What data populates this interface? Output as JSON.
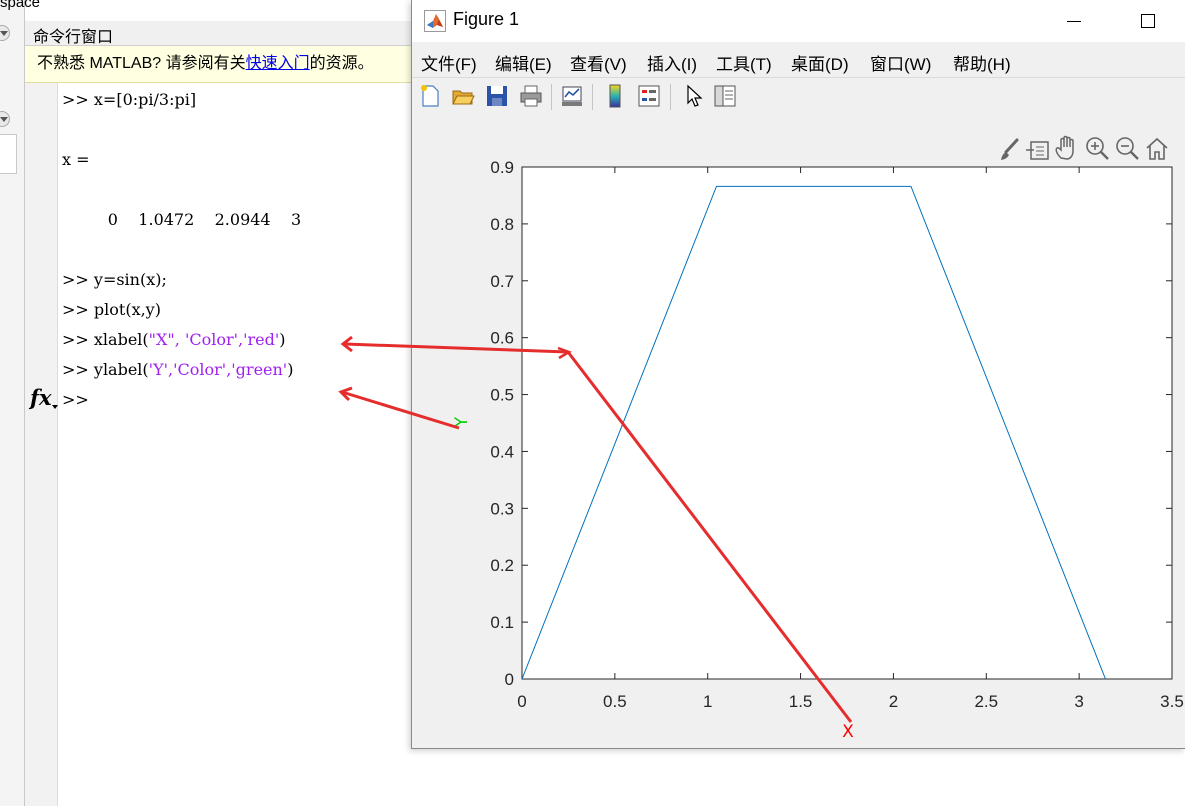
{
  "workspace": {
    "title": "space"
  },
  "command_window": {
    "title": "命令行窗口",
    "info": {
      "prefix": "不熟悉 MATLAB? 请参阅有关",
      "link": "快速入门",
      "suffix": "的资源。"
    },
    "lines": {
      "l1": ">> x=[0:pi/3:pi]",
      "l2": "x =",
      "l3": "         0    1.0472    2.0944    3",
      "l4": ">> y=sin(x);",
      "l5": ">> plot(x,y)",
      "l6a": ">> xlabel(",
      "l6b": "\"X\", 'Color','red'",
      "l6c": ")",
      "l7a": ">> ylabel(",
      "l7b": "'Y','Color','green'",
      "l7c": ")",
      "l8": ">>"
    }
  },
  "figure": {
    "title": "Figure 1",
    "menu": {
      "file": "文件(F)",
      "edit": "编辑(E)",
      "view": "查看(V)",
      "insert": "插入(I)",
      "tools": "工具(T)",
      "desktop": "桌面(D)",
      "window": "窗口(W)",
      "help": "帮助(H)"
    }
  },
  "colors": {
    "line": "#0072bd",
    "xlabel": "#ff0000",
    "ylabel": "#00cc00",
    "annotation": "#e52d2d",
    "string": "#a020f0"
  },
  "chart_data": {
    "type": "line",
    "x": [
      0,
      1.0472,
      2.0944,
      3.1416
    ],
    "series": [
      {
        "values": [
          0,
          0.866,
          0.866,
          0.0001
        ]
      }
    ],
    "xlabel": "X",
    "ylabel": "Y",
    "xlim": [
      0,
      3.5
    ],
    "ylim": [
      0,
      0.9
    ],
    "xticks": [
      "0",
      "0.5",
      "1",
      "1.5",
      "2",
      "2.5",
      "3",
      "3.5"
    ],
    "yticks": [
      "0",
      "0.1",
      "0.2",
      "0.3",
      "0.4",
      "0.5",
      "0.6",
      "0.7",
      "0.8",
      "0.9"
    ],
    "grid": false
  }
}
